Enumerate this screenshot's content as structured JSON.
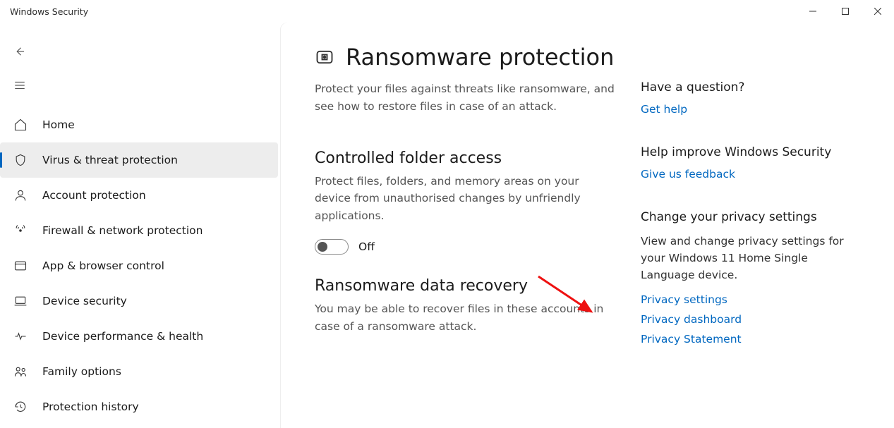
{
  "window": {
    "title": "Windows Security"
  },
  "sidebar": {
    "items": [
      {
        "label": "Home"
      },
      {
        "label": "Virus & threat protection"
      },
      {
        "label": "Account protection"
      },
      {
        "label": "Firewall & network protection"
      },
      {
        "label": "App & browser control"
      },
      {
        "label": "Device security"
      },
      {
        "label": "Device performance & health"
      },
      {
        "label": "Family options"
      },
      {
        "label": "Protection history"
      }
    ]
  },
  "main": {
    "title": "Ransomware protection",
    "lead": "Protect your files against threats like ransomware, and see how to restore files in case of an attack.",
    "section1": {
      "heading": "Controlled folder access",
      "desc": "Protect files, folders, and memory areas on your device from unauthorised changes by unfriendly applications.",
      "toggle_label": "Off"
    },
    "section2": {
      "heading": "Ransomware data recovery",
      "desc": "You may be able to recover files in these accounts in case of a ransomware attack."
    }
  },
  "side": {
    "q": {
      "heading": "Have a question?",
      "link1": "Get help"
    },
    "help": {
      "heading": "Help improve Windows Security",
      "link1": "Give us feedback"
    },
    "privacy": {
      "heading": "Change your privacy settings",
      "desc": "View and change privacy settings for your Windows 11 Home Single Language device.",
      "link1": "Privacy settings",
      "link2": "Privacy dashboard",
      "link3": "Privacy Statement"
    }
  }
}
